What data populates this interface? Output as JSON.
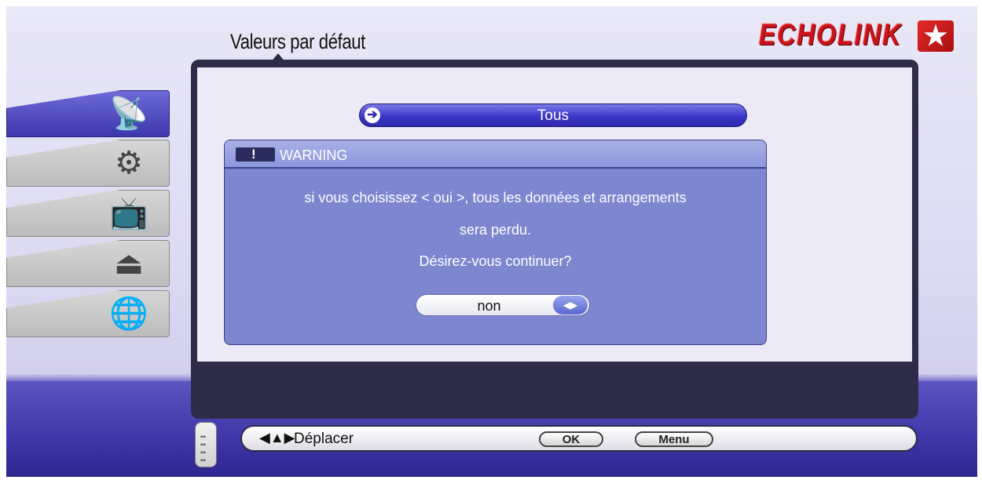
{
  "page": {
    "title": "Valeurs par défaut"
  },
  "brand": {
    "name": "ECHOLINK"
  },
  "sidebar": {
    "items": [
      {
        "icon": "satellite-dish-icon",
        "active": true
      },
      {
        "icon": "gears-icon",
        "active": false
      },
      {
        "icon": "tv-icon",
        "active": false
      },
      {
        "icon": "usb-icon",
        "active": false
      },
      {
        "icon": "globe-icon",
        "active": false
      }
    ]
  },
  "main": {
    "selected_option": "Tous"
  },
  "dialog": {
    "title": "WARNING",
    "icon": "!",
    "message_line1": "si vous choisissez < oui >, tous les données et arrangements",
    "message_line2": "sera perdu.",
    "question": "Désirez-vous continuer?",
    "choice_value": "non"
  },
  "footer": {
    "move_label": "Déplacer",
    "ok_label": "OK",
    "menu_label": "Menu"
  },
  "colors": {
    "accent": "#3c35c9",
    "dialog_bg": "#7d86cf",
    "brand_red": "#c8141c"
  }
}
